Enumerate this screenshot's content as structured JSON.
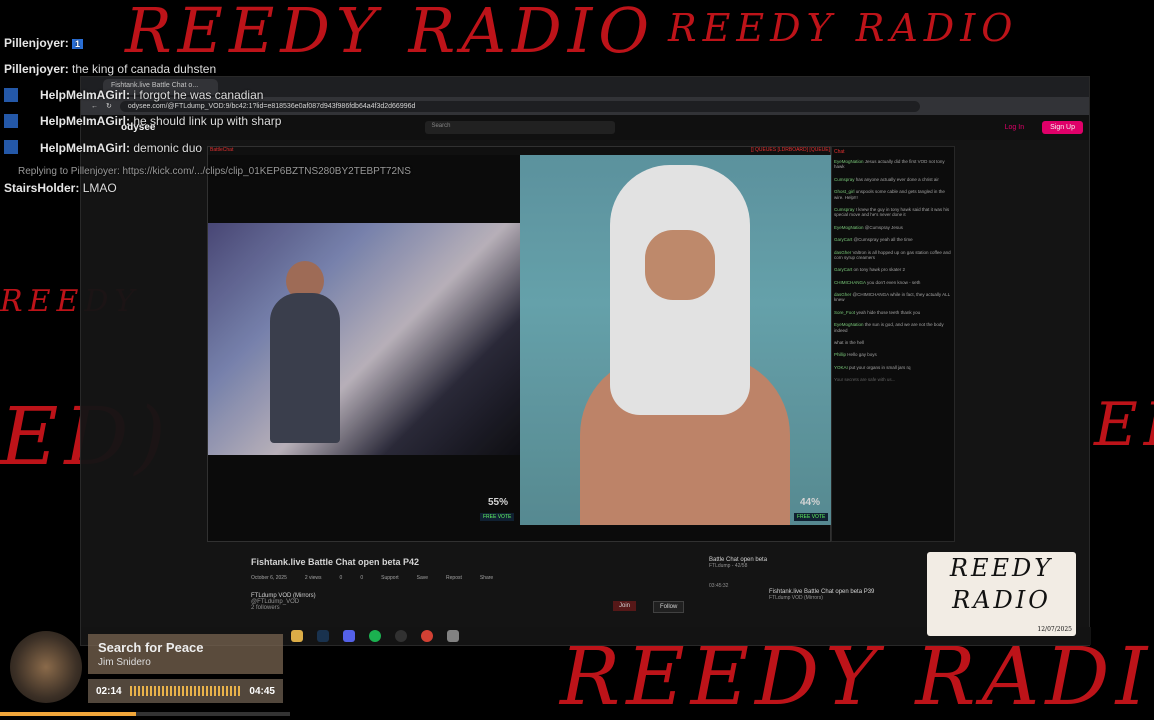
{
  "overlay": {
    "scrawl_text": "REEDY RADIO",
    "scrawl_fragments": [
      "REEDY RADIO",
      "REEDY RADIO",
      "REEDY",
      "ED)",
      "REEDY RADI",
      "EE"
    ]
  },
  "chat_overlay": [
    {
      "user": "Pillenjoyer:",
      "msg": "1"
    },
    {
      "user": "Pillenjoyer:",
      "msg": "the king of canada duhsten"
    },
    {
      "user": "HelpMeImAGirl:",
      "msg": "i forgot he was canadian"
    },
    {
      "user": "HelpMeImAGirl:",
      "msg": "he should link up with sharp"
    },
    {
      "user": "HelpMeImAGirl:",
      "msg": "demonic duo"
    },
    {
      "user": "Replying to Pillenjoyer:",
      "msg": "https://kick.com/.../clips/clip_01KEP6BZTNS280BY2TEBPT72NS"
    },
    {
      "user": "StairsHolder:",
      "msg": "LMAO"
    }
  ],
  "browser": {
    "tab_title": "Fishtank.live Battle Chat o...",
    "url": "odysee.com/@FTLdump_VOD:9/bc42:1?lid=e818536e0af087d943f986fdb64a4f3d2d66996d",
    "site": "odysee",
    "search_placeholder": "Search",
    "login": "Log In",
    "signup": "Sign Up"
  },
  "player": {
    "left_label": "BattleChat",
    "right_label": "[] QUEUES [LDRBOARD] [QUEUE]",
    "left_pct": "55%",
    "right_pct": "44%",
    "vote_label": "FREE VOTE"
  },
  "chat_panel": {
    "header": "Chat",
    "messages": [
      {
        "name": "EyeMogNation",
        "text": "Jesus actually did the first VOD not tony hawk"
      },
      {
        "name": "Cumspray",
        "text": "has anyone actually ever done a christ air"
      },
      {
        "name": "Ghost_girl",
        "text": "unspools some cable and gets tangled in the wire. Help!!!"
      },
      {
        "name": "Cumspray",
        "text": "I knew the guy in tony hawk said that it was his special move and he's never done it"
      },
      {
        "name": "EyeMogNation",
        "text": "@Cumspray Jesus"
      },
      {
        "name": "GaryCart",
        "text": "@Cumspray yeah all the time"
      },
      {
        "name": "dasGher",
        "text": "Valtron is all hopped up on gas station coffee and corn syrup creamers"
      },
      {
        "name": "GaryCart",
        "text": "on tony hawk pro skater 2"
      },
      {
        "name": "CHIMICHANGA",
        "text": "you don't even know - seth"
      },
      {
        "name": "dasGher",
        "text": "@CHIMICHANGA while in fact, they actually ALL knew"
      },
      {
        "name": "Sore_Foot",
        "text": "yeah hide those teeth thank you"
      },
      {
        "name": "EyeMogNation",
        "text": "the sun is god, and we are not the body indeed"
      },
      {
        "name": "",
        "text": "what in the hell"
      },
      {
        "name": "Phillip",
        "text": "Hello gay boys"
      },
      {
        "name": "YOKAI",
        "text": "put your organs in small jars rq"
      }
    ],
    "input_placeholder": "Your secrets are safe with us..."
  },
  "video": {
    "title": "Fishtank.live Battle Chat open beta P42",
    "date": "October 6, 2025",
    "views": "2 views",
    "likes": "0",
    "dislikes": "0",
    "actions": [
      "Support",
      "Save",
      "Repost",
      "Share"
    ],
    "channel": "FTLdump VOD (Mirrors)",
    "channel_handle": "@FTLdump_VOD",
    "followers": "2 followers",
    "join": "Join",
    "follow": "Follow",
    "playlist_title": "Battle Chat open beta",
    "playlist_sub": "FTLdump - 42/58",
    "related_title": "Fishtank.live Battle Chat open beta P39",
    "related_channel": "FTLdump VOD (Mirrors)",
    "related_duration": "03:45:32"
  },
  "logo": {
    "line1": "REEDY",
    "line2": "RADIO",
    "date": "12/07/2025"
  },
  "now_playing": {
    "song": "Search for Peace",
    "artist": "Jim Snidero",
    "elapsed": "02:14",
    "total": "04:45",
    "progress": 0.47
  }
}
